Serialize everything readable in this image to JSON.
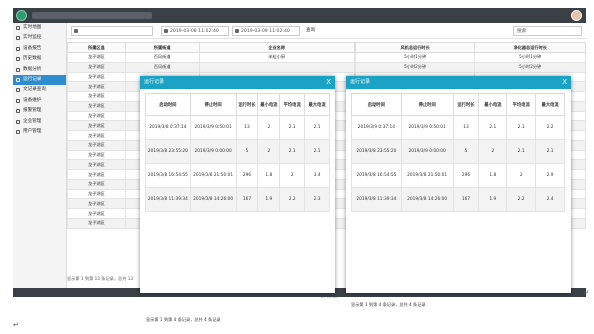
{
  "header": {
    "system_title": ""
  },
  "sidebar": {
    "items": [
      {
        "label": "实时地图",
        "icon": "map-icon",
        "active": false
      },
      {
        "label": "实时监控",
        "icon": "monitor-icon",
        "active": false
      },
      {
        "label": "设备报告",
        "icon": "report-icon",
        "active": false
      },
      {
        "label": "历史数据",
        "icon": "history-icon",
        "active": false
      },
      {
        "label": "数据分析",
        "icon": "chart-icon",
        "active": false
      },
      {
        "label": "运行记录",
        "icon": "document-icon",
        "active": true
      },
      {
        "label": "文记录查询",
        "icon": "file-icon",
        "active": false
      },
      {
        "label": "设备维护",
        "icon": "wrench-icon",
        "active": false
      },
      {
        "label": "报警管理",
        "icon": "bell-icon",
        "active": false
      },
      {
        "label": "企业管理",
        "icon": "gear-icon",
        "active": false
      },
      {
        "label": "用户管理",
        "icon": "user-icon",
        "active": false
      }
    ]
  },
  "filter": {
    "start_time": "2019-03-08 11:02:40",
    "end_time": "2019-03-09 11:02:40",
    "query_label": "查询",
    "search_placeholder": "搜索"
  },
  "main_table": {
    "headers": [
      "所属区县",
      "所属街道",
      "企业名称",
      "",
      "风机总运行时长",
      "净化器总运行时长"
    ],
    "rows": [
      [
        "龙子湖区",
        "百风街道",
        "米粒小厨",
        "",
        "5小时1分钟",
        "5小时1分钟"
      ],
      [
        "龙子湖区",
        "百风街道",
        "",
        "",
        "5小时2分钟",
        "5小时2分钟"
      ],
      [
        "龙子湖区",
        "",
        "",
        "",
        "",
        ""
      ],
      [
        "龙子湖区",
        "",
        "",
        "",
        "",
        ""
      ],
      [
        "龙子湖区",
        "",
        "",
        "",
        "",
        ""
      ],
      [
        "龙子湖区",
        "",
        "",
        "",
        "",
        ""
      ],
      [
        "龙子湖区",
        "",
        "",
        "",
        "",
        ""
      ],
      [
        "龙子湖区",
        "",
        "",
        "",
        "",
        ""
      ],
      [
        "龙子湖区",
        "",
        "",
        "",
        "",
        ""
      ],
      [
        "龙子湖区",
        "",
        "",
        "",
        "",
        ""
      ],
      [
        "龙子湖区",
        "",
        "",
        "",
        "",
        ""
      ],
      [
        "龙子湖区",
        "",
        "",
        "",
        "",
        ""
      ],
      [
        "龙子湖区",
        "",
        "",
        "",
        "",
        ""
      ],
      [
        "龙子湖区",
        "",
        "",
        "",
        "",
        ""
      ],
      [
        "龙子湖区",
        "",
        "",
        "",
        "",
        ""
      ],
      [
        "龙子湖区",
        "",
        "",
        "",
        "",
        ""
      ],
      [
        "龙子湖区",
        "",
        "",
        "",
        "",
        ""
      ],
      [
        "龙子湖区",
        "",
        "",
        "",
        "",
        ""
      ]
    ],
    "footer": "显示第 1 到第 13 条记录，总共 13",
    "status_tail": "总共数据，"
  },
  "modal_left": {
    "title": "运行记录",
    "close": "X",
    "headers": [
      "启动时间",
      "停止时间",
      "运行时长",
      "最小电流",
      "平均电流",
      "最大电流"
    ],
    "rows": [
      [
        "2019/3/8 0:37:14",
        "2019/3/9 0:50:01",
        "13",
        "2",
        "2.1",
        "2.1"
      ],
      [
        "2019/3/8 23:55:20",
        "2019/3/9 0:00:00",
        "5",
        "2",
        "2.1",
        "2.1"
      ],
      [
        "2019/3/8 16:54:55",
        "2019/3/8 21:50:01",
        "296",
        "1.8",
        "2",
        "3.4"
      ],
      [
        "2019/3/8 11:39:34",
        "2019/3/8 14:26:00",
        "167",
        "1.9",
        "2.2",
        "2.3"
      ]
    ]
  },
  "modal_right": {
    "title": "运行记录",
    "close": "X",
    "headers": [
      "启动时间",
      "停止时间",
      "运行时长",
      "最小电流",
      "平均电流",
      "最大电流"
    ],
    "rows": [
      [
        "2019/3/9 0:37:14",
        "2019/3/9 0:50:01",
        "13",
        "2.1",
        "2.1",
        "2.2"
      ],
      [
        "2019/3/8 23:55:20",
        "2019/3/9 0:00:00",
        "5",
        "2",
        "2.1",
        "2.1"
      ],
      [
        "2019/3/8 16:54:55",
        "2019/3/8 21:50:01",
        "296",
        "1.8",
        "2",
        "2.9"
      ],
      [
        "2019/3/8 11:39:34",
        "2019/3/8 14:26:00",
        "167",
        "1.9",
        "2.2",
        "2.4"
      ]
    ],
    "summary": "显示第 1 到第 4 条记录，总共 4 条记录"
  },
  "document": {
    "caption": "显示第 1 到第 4 条记录，总共 4 条记录",
    "return_mark": "↵"
  },
  "colors": {
    "topbar": "#3b3f46",
    "active_nav": "#2f8ccd",
    "modal_header": "#1aa3c4",
    "link_blue": "#2f7ed8"
  }
}
